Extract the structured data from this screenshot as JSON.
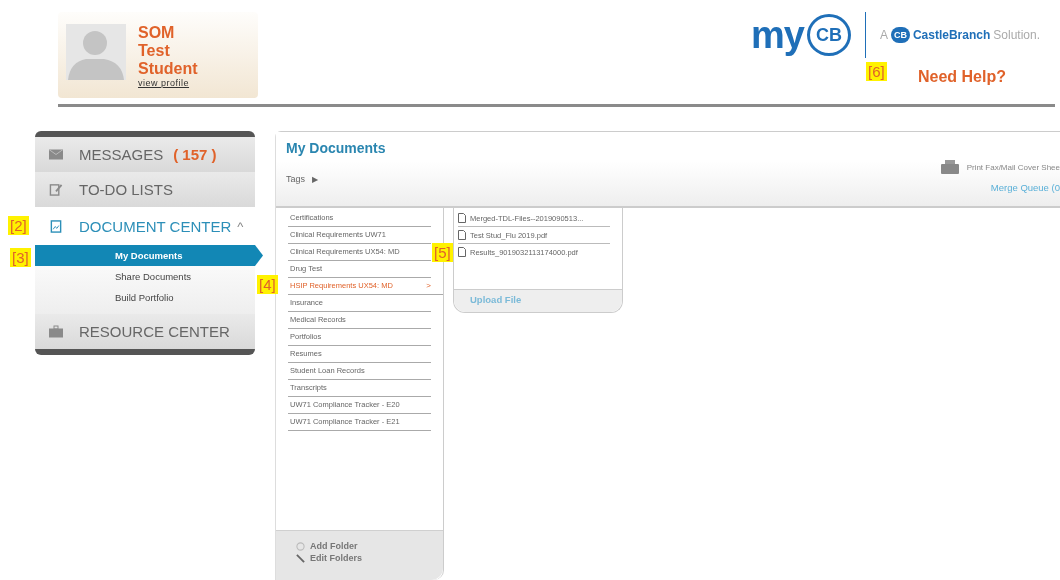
{
  "profile": {
    "name_lines": [
      "SOM",
      "Test",
      "Student"
    ],
    "link": "view profile"
  },
  "logo": {
    "brand": "my",
    "mark": "CB",
    "tagline_prefix": "A",
    "tagline_mark": "CB",
    "tagline_brand_a": "Castle",
    "tagline_brand_b": "Branch",
    "tagline_suffix": "Solution."
  },
  "help": {
    "label": "Need Help?"
  },
  "nav": [
    {
      "kind": "messages",
      "label": "MESSAGES",
      "count": "( 157 )",
      "expanded": false
    },
    {
      "kind": "todo",
      "label": "TO-DO LISTS",
      "expanded": false
    },
    {
      "kind": "documents",
      "label": "DOCUMENT CENTER",
      "caret": "^",
      "expanded": true,
      "children": [
        {
          "label": "My Documents",
          "selected": true
        },
        {
          "label": "Share Documents",
          "selected": false
        },
        {
          "label": "Build Portfolio",
          "selected": false
        }
      ]
    },
    {
      "kind": "resources",
      "label": "RESOURCE CENTER",
      "expanded": false
    }
  ],
  "documents": {
    "title": "My Documents",
    "tags_label": "Tags",
    "tags_arrow": "▶",
    "print_label": "Print Fax/Mail Cover Shee",
    "merge_queue": "Merge Queue (0",
    "folder_arrow": ">",
    "folders": [
      {
        "label": "Certifications",
        "selected": false
      },
      {
        "label": "Clinical Requirements UW71",
        "selected": false
      },
      {
        "label": "Clinical Requirements UX54: MD",
        "selected": false
      },
      {
        "label": "Drug Test",
        "selected": false
      },
      {
        "label": "HSIP Requirements UX54: MD",
        "selected": true
      },
      {
        "label": "Insurance",
        "selected": false
      },
      {
        "label": "Medical Records",
        "selected": false
      },
      {
        "label": "Portfolios",
        "selected": false
      },
      {
        "label": "Resumes",
        "selected": false
      },
      {
        "label": "Student Loan Records",
        "selected": false
      },
      {
        "label": "Transcripts",
        "selected": false
      },
      {
        "label": "UW71 Compliance Tracker - E20",
        "selected": false
      },
      {
        "label": "UW71 Compliance Tracker - E21",
        "selected": false
      }
    ],
    "files": [
      "Merged-TDL-Files--2019090513...",
      "Test Stud_Flu 2019.pdf",
      "Results_9019032113174000.pdf"
    ],
    "upload": "Upload File",
    "folder_actions": [
      {
        "kind": "add",
        "label": "Add Folder"
      },
      {
        "kind": "edit",
        "label": "Edit Folders"
      }
    ]
  },
  "callouts": [
    "[2]",
    "[3]",
    "[4]",
    "[5]",
    "[6]"
  ]
}
